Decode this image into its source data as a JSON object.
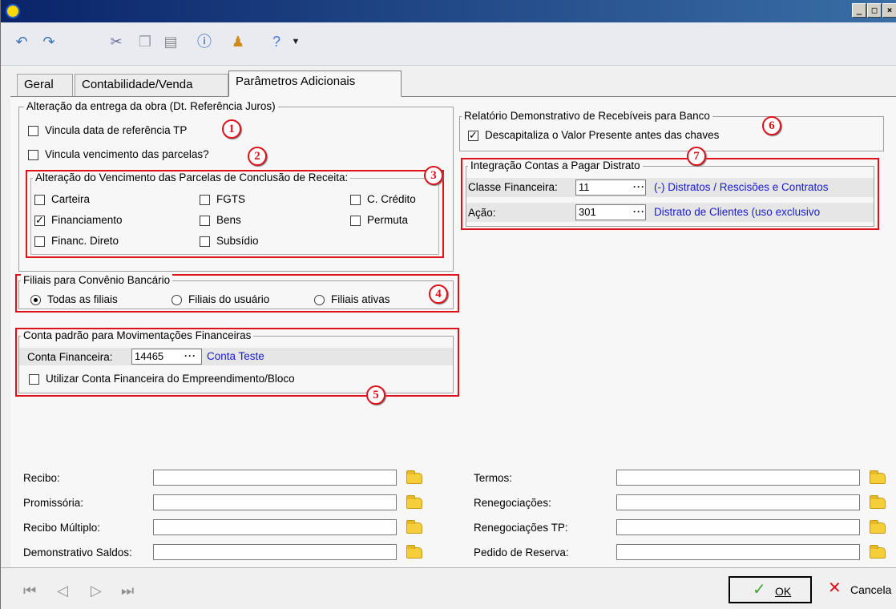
{
  "toolbar": {
    "icons": [
      "undo-icon",
      "redo-icon",
      "cut-icon",
      "copy-icon",
      "paste-icon",
      "info-icon",
      "user-icon",
      "help-icon",
      "dropdown-arrow-icon"
    ]
  },
  "tabs": [
    "Geral",
    "Contabilidade/Venda",
    "Parâmetros Adicionais"
  ],
  "groups": {
    "entrega": {
      "title": "Alteração da entrega da obra (Dt. Referência Juros)",
      "vincula_ref": "Vincula data de referência TP",
      "vincula_venc": "Vincula vencimento das parcelas?"
    },
    "parcelas": {
      "title": "Alteração do Vencimento das Parcelas de Conclusão de Receita:",
      "items": [
        "Carteira",
        "FGTS",
        "C. Crédito",
        "Financiamento",
        "Bens",
        "Permuta",
        "Financ. Direto",
        "Subsídio"
      ]
    },
    "filiais": {
      "title": "Filiais para Convênio Bancário",
      "options": [
        "Todas as filiais",
        "Filiais do usuário",
        "Filiais ativas"
      ],
      "selected": "Todas as filiais"
    },
    "conta": {
      "title": "Conta padrão para Movimentações Financeiras",
      "label": "Conta Financeira:",
      "value": "14465",
      "desc": "Conta Teste",
      "checkbox": "Utilizar Conta Financeira do Empreendimento/Bloco"
    },
    "relatorio": {
      "title": "Relatório Demonstrativo de Recebíveis para Banco",
      "checkbox": "Descapitaliza o Valor Presente antes das chaves"
    },
    "integracao": {
      "title": "Integração Contas a Pagar Distrato",
      "classe_label": "Classe Financeira:",
      "classe_value": "11",
      "classe_desc": "(-) Distratos / Rescisões e Contratos",
      "acao_label": "Ação:",
      "acao_value": "301",
      "acao_desc": "Distrato de Clientes (uso exclusivo"
    }
  },
  "badges": [
    "1",
    "2",
    "3",
    "4",
    "5",
    "6",
    "7"
  ],
  "documents_left": [
    "Recibo:",
    "Promissória:",
    "Recibo Múltiplo:",
    "Demonstrativo Saldos:"
  ],
  "documents_right": [
    "Termos:",
    "Renegociações:",
    "Renegociações TP:",
    "Pedido de Reserva:"
  ],
  "dots": "···",
  "footer": {
    "ok_label": "OK",
    "cancel_label": "Cancela"
  },
  "colors": {
    "highlight": "#e0101a",
    "link": "#1a1ad0"
  }
}
